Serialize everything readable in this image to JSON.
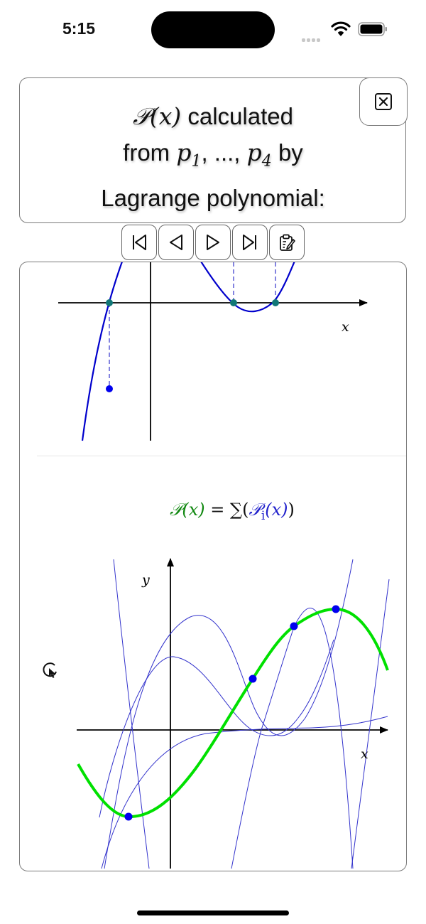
{
  "status_bar": {
    "time": "5:15",
    "signal_icon": "signal-bars-icon",
    "wifi_icon": "wifi-icon",
    "battery_icon": "battery-icon"
  },
  "caption": {
    "line1_math": "𝒫(x)",
    "line1_text": " calculated",
    "line2_pre": "from ",
    "line2_p1": "p",
    "line2_sub1": "1",
    "line2_mid": ", ..., ",
    "line2_p4": "p",
    "line2_sub4": "4",
    "line2_post": " by",
    "line3": "Lagrange polynomial:"
  },
  "close_button": {
    "icon": "close-box-icon"
  },
  "toolbar": {
    "buttons": [
      {
        "name": "first",
        "icon": "skip-first-icon"
      },
      {
        "name": "previous",
        "icon": "previous-icon"
      },
      {
        "name": "next",
        "icon": "next-icon"
      },
      {
        "name": "last",
        "icon": "skip-last-icon"
      },
      {
        "name": "clipboard",
        "icon": "clipboard-edit-icon"
      }
    ]
  },
  "top_plot": {
    "x_axis_label": "x",
    "curve_color": "#0000cc",
    "root_color": "#117777",
    "point_color": "#0000ee"
  },
  "bottom_plot": {
    "formula_P": "𝒫(x)",
    "formula_eq": " = ∑(",
    "formula_Pi": "𝒫",
    "formula_sub_i": "i",
    "formula_Pi_arg": "(x)",
    "formula_close": ")",
    "x_axis_label": "x",
    "y_axis_label": "y",
    "sum_color": "#00e000",
    "basis_color": "#3333cc",
    "point_color": "#0000ee"
  },
  "cursor_icon": "pointer-cursor-icon"
}
